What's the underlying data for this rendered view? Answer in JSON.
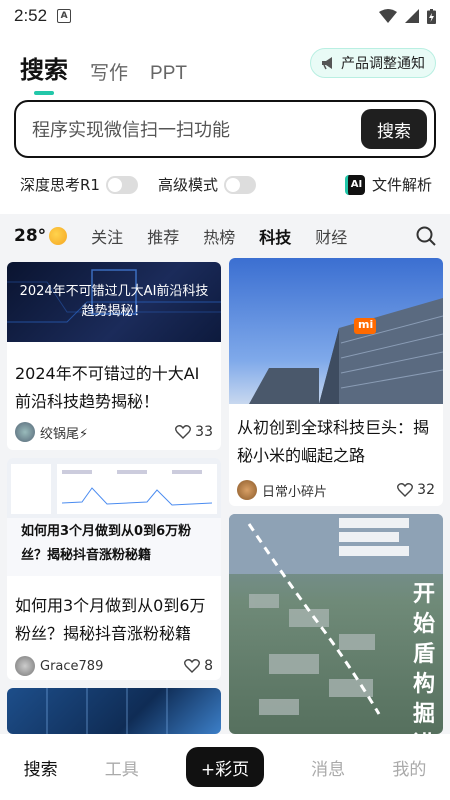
{
  "status_bar": {
    "time": "2:52",
    "notif_icon": "A"
  },
  "top_tabs": {
    "search": "搜索",
    "write": "写作",
    "ppt": "PPT"
  },
  "notice_label": "产品调整通知",
  "search": {
    "value": "程序实现微信扫一扫功能",
    "button_label": "搜索"
  },
  "options": {
    "deep_think": "深度思考R1",
    "advanced": "高级模式",
    "file_parse": "文件解析",
    "ai_badge": "AI"
  },
  "weather": {
    "temp": "28°"
  },
  "categories": [
    "关注",
    "推荐",
    "热榜",
    "科技",
    "财经"
  ],
  "active_category": "科技",
  "feed": [
    {
      "image_text": "2024年不可错过几大AI前沿科技趋势揭秘！",
      "title": "2024年不可错过的十大AI前沿科技趋势揭秘！",
      "author": "绞锅尾⚡",
      "likes": "33"
    },
    {
      "image_text": "mi",
      "title": "从初创到全球科技巨头：揭秘小米的崛起之路",
      "author": "日常小碎片",
      "likes": "32"
    },
    {
      "image_text": "如何用3个月做到从0到6万粉丝？揭秘抖音涨粉秘籍",
      "title": "如何用3个月做到从0到6万粉丝？揭秘抖音涨粉秘籍",
      "author": "Grace789",
      "likes": "8"
    },
    {
      "image_text": "开始盾构掘进",
      "title": "",
      "author": "",
      "likes": ""
    }
  ],
  "bottom_nav": {
    "search": "搜索",
    "tools": "工具",
    "ppt": "+彩页",
    "messages": "消息",
    "me": "我的"
  }
}
